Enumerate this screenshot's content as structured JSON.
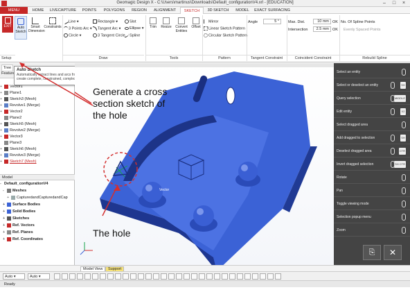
{
  "window": {
    "title": "Geomagic Design X - C:\\Users\\martinus\\Downloads\\Default_configurationV4.xrl - [EDUCATION]"
  },
  "tabs": [
    "MENU",
    "HOME",
    "LIVECAPTURE",
    "POINTS",
    "POLYGONS",
    "REGION",
    "ALIGNMENT",
    "SKETCH",
    "3D SKETCH",
    "MODEL",
    "EXACT SURFACING"
  ],
  "active_tab": "SKETCH",
  "ribbon": {
    "exit": "EXIT",
    "auto_sketch": "Auto Sketch",
    "smart_dimension": "Smart Dimension",
    "constraints": "Constraints",
    "draw_items": [
      "Line",
      "3 Points Arc",
      "Circle",
      "Rectangle",
      "Tangent Arc",
      "3 Tangent Circle",
      "Slot",
      "Ellipse",
      "Spline"
    ],
    "trim": "Trim",
    "resize": "Resize",
    "convert_entities": "Convert Entities",
    "offset": "Offset",
    "mirror": "Mirror",
    "linear_pattern": "Linear Sketch Pattern",
    "circular_pattern": "Circular Sketch Pattern",
    "angle_label": "Angle",
    "angle_value": "5 °",
    "max_dist_label": "Max. Dist.",
    "max_dist_value": "10 mm",
    "ok": "OK",
    "intersection_label": "Intersection",
    "intersection_value": "2.5 mm",
    "spline_points_label": "No. Of Spline Points",
    "evenly_spaced": "Evenly Spaced Points",
    "groups": [
      "Setup",
      "Draw",
      "Tools",
      "Pattern",
      "Tangent Constraint",
      "Coincident Constraint",
      "Rebuild Spline"
    ]
  },
  "tooltip": {
    "title": "Auto Sketch",
    "body": "Automatically extract lines and arcs from polylines to create complete, constrained, complex sketch profiles."
  },
  "left_panel": {
    "tabs": [
      "Tree",
      "Feature"
    ],
    "tree": [
      "Vector1",
      "Plane1",
      "Sketch3 (Mesh)",
      "Revolve1 (Merge)",
      "Vector2",
      "Plane2",
      "Sketch5 (Mesh)",
      "Revolve2 (Merge)",
      "Vector3",
      "Plane3",
      "Sketch6 (Mesh)",
      "Revolve3 (Merge)",
      "Sketch7 (Mesh)"
    ],
    "model_label": "Model",
    "model_tree": [
      "Default_configurationV4",
      "Meshes",
      "CapturedandCapturedandCap",
      "Surface Bodies",
      "Solid Bodies",
      "Sketches",
      "Ref. Vectors",
      "Ref. Planes",
      "Ref. Coordinates"
    ]
  },
  "viewport": {
    "vector_label": "Vector",
    "annotation_main": [
      "Generate a cross",
      "section sketch of",
      "the hole"
    ],
    "annotation_hole": "The hole"
  },
  "right_panel": {
    "items": [
      {
        "label": "Select an entity",
        "key": ""
      },
      {
        "label": "Select or deselect an entity",
        "key": "SH"
      },
      {
        "label": "Query selection",
        "key": "MIDDLE"
      },
      {
        "label": "Edit entity",
        "key": "X2"
      },
      {
        "label": "Select dragged area",
        "key": ""
      },
      {
        "label": "Add dragged to selection",
        "key": "SH"
      },
      {
        "label": "Deselect dragged area",
        "key": "CTR"
      },
      {
        "label": "Invert dragged selection",
        "key": "SH CTR"
      },
      {
        "label": "Rotate",
        "key": ""
      },
      {
        "label": "Pan",
        "key": ""
      },
      {
        "label": "Toggle viewing mode",
        "key": ""
      },
      {
        "label": "Selection popup menu",
        "key": ""
      },
      {
        "label": "Zoom",
        "key": ""
      }
    ]
  },
  "bottom_tabs": [
    "Model View",
    "Support"
  ],
  "bottom_bar": {
    "auto1": "Auto",
    "auto2": "Auto"
  },
  "status": "Ready",
  "colors": {
    "accent": "#c62828",
    "model_blue": "#3b62d6",
    "annotation_red": "#d32f2f"
  }
}
